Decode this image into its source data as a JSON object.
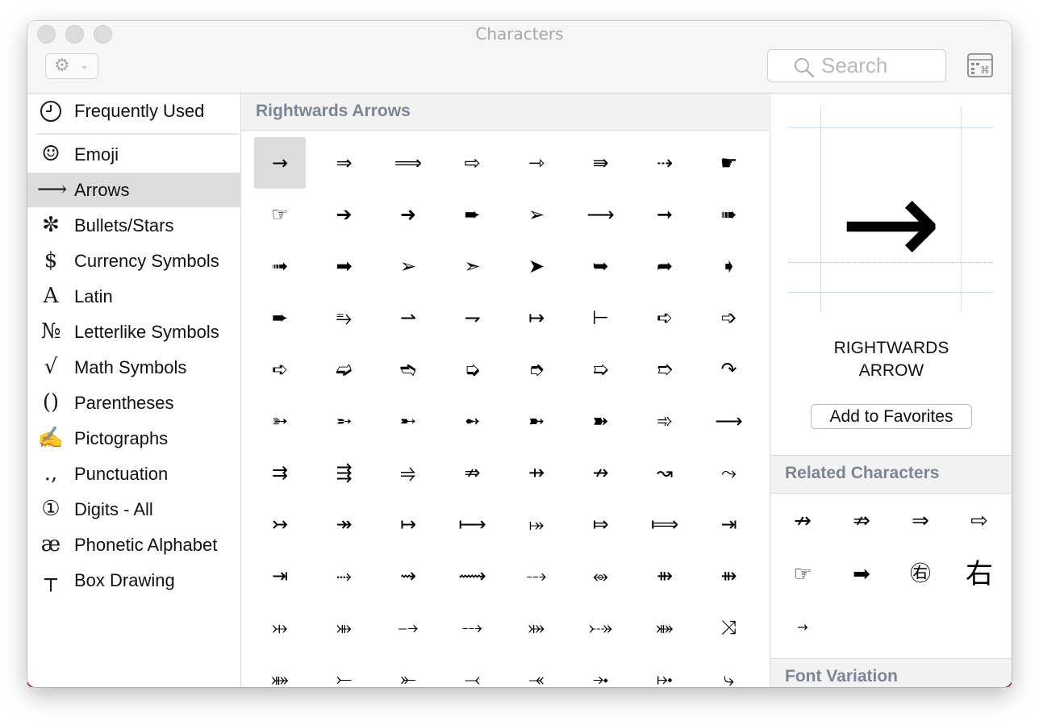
{
  "window": {
    "title": "Characters",
    "gear_icon": "⚙",
    "chevron_icon": "⌄"
  },
  "search": {
    "placeholder": "Search"
  },
  "sidebar": {
    "items": [
      {
        "icon": "🕘",
        "label": "Frequently Used",
        "selected": false
      },
      {
        "icon": "☺",
        "label": "Emoji",
        "selected": false
      },
      {
        "icon": "⟶",
        "label": "Arrows",
        "selected": true
      },
      {
        "icon": "✼",
        "label": "Bullets/Stars",
        "selected": false
      },
      {
        "icon": "$",
        "label": "Currency Symbols",
        "selected": false
      },
      {
        "icon": "A",
        "label": "Latin",
        "selected": false
      },
      {
        "icon": "№",
        "label": "Letterlike Symbols",
        "selected": false
      },
      {
        "icon": "√",
        "label": "Math Symbols",
        "selected": false
      },
      {
        "icon": "()",
        "label": "Parentheses",
        "selected": false
      },
      {
        "icon": "✍",
        "label": "Pictographs",
        "selected": false
      },
      {
        "icon": ".,",
        "label": "Punctuation",
        "selected": false
      },
      {
        "icon": "①",
        "label": "Digits - All",
        "selected": false
      },
      {
        "icon": "æ",
        "label": "Phonetic Alphabet",
        "selected": false
      },
      {
        "icon": "┬",
        "label": "Box Drawing",
        "selected": false
      }
    ]
  },
  "main": {
    "section_title": "Rightwards Arrows",
    "characters": [
      "→",
      "⇒",
      "⟹",
      "⇨",
      "⇾",
      "⇛",
      "⇢",
      "☛",
      "☞",
      "➔",
      "➜",
      "➨",
      "➢",
      "⟶",
      "➞",
      "➠",
      "➟",
      "➡",
      "➢",
      "➣",
      "➤",
      "➥",
      "➦",
      "➧",
      "➨",
      "⥱",
      "⇀",
      "⇁",
      "↦",
      "⊢",
      "➪",
      "➩",
      "➪",
      "➫",
      "➬",
      "➭",
      "➮",
      "➯",
      "➱",
      "↷",
      "➳",
      "➵",
      "➸",
      "➻",
      "➼",
      "➽",
      "➾",
      "⟶",
      "⇉",
      "⇶",
      "⥤",
      "⇏",
      "⇸",
      "↛",
      "↝",
      "⤳",
      "↣",
      "↠",
      "↦",
      "⟼",
      "⤅",
      "⤇",
      "⟾",
      "⇥",
      "⇥",
      "⤑",
      "⇝",
      "⟿",
      "⤏",
      "⥈",
      "⇻",
      "⇻",
      "⤔",
      "⤕",
      "⤍",
      "⤏",
      "⤗",
      "⤐",
      "⤘",
      "⤨",
      "⤘",
      "⤚",
      "⤜",
      "⤙",
      "⤛",
      "⤞",
      "⤠",
      "⤷"
    ],
    "selected_index": 0
  },
  "detail": {
    "character": "→",
    "name": "RIGHTWARDS ARROW",
    "add_favorites_label": "Add to Favorites"
  },
  "related": {
    "title": "Related Characters",
    "characters": [
      "↛",
      "⇏",
      "⇒",
      "⇨",
      "☞",
      "➡",
      "㊨",
      "右",
      "→"
    ]
  },
  "font_variation": {
    "title": "Font Variation"
  }
}
